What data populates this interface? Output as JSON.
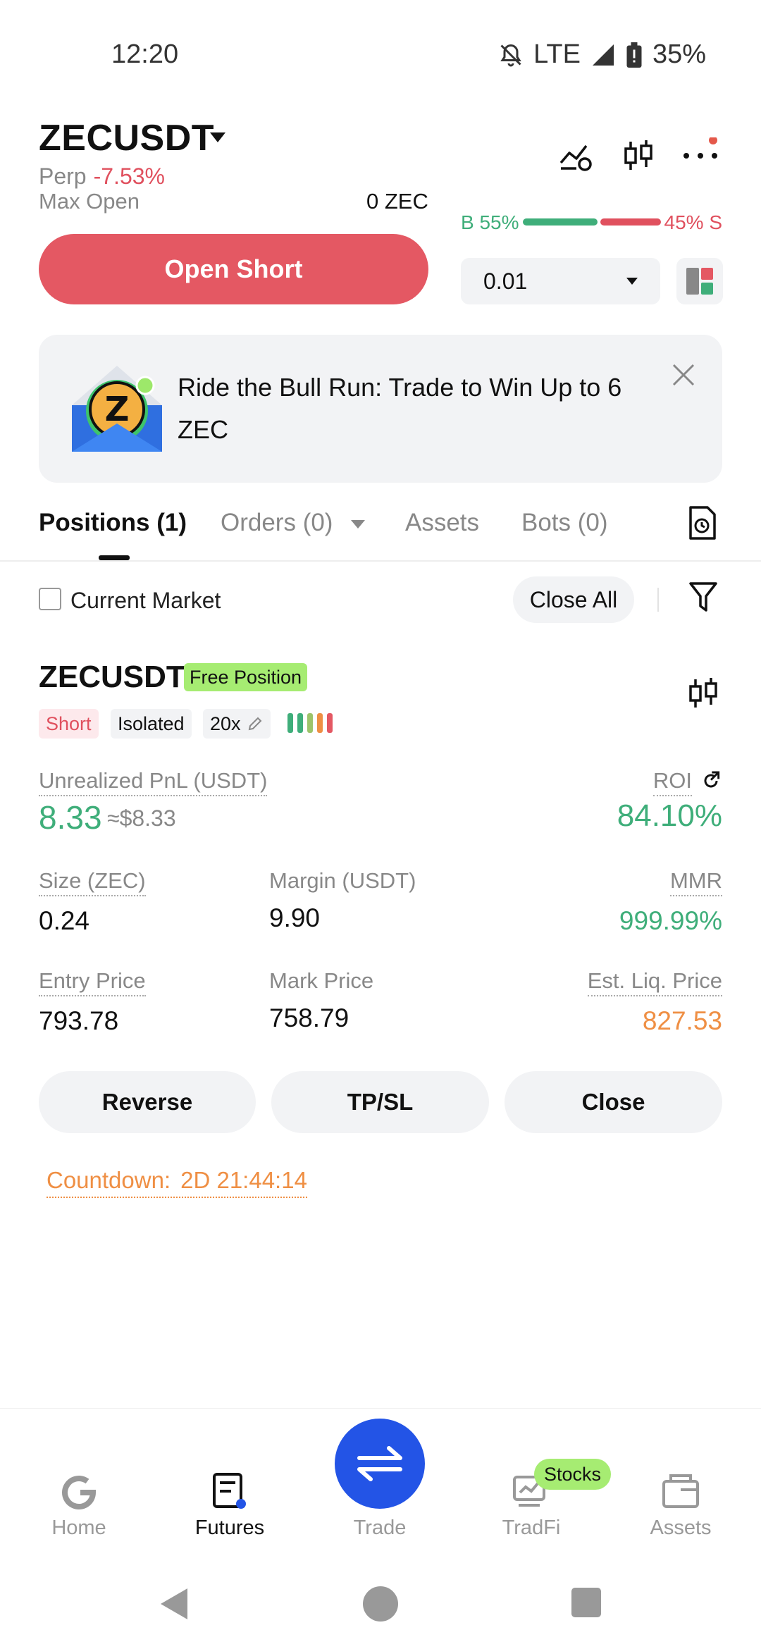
{
  "status_bar": {
    "time": "12:20",
    "network": "LTE",
    "battery": "35%"
  },
  "header": {
    "pair": "ZECUSDT",
    "perp_label": "Perp",
    "change": "-7.53%",
    "max_open_label": "Max Open",
    "max_open_value": "0 ZEC",
    "buy_ratio_label": "B 55%",
    "sell_ratio_label": "45% S",
    "buy_ratio": 0.55,
    "open_short_label": "Open Short",
    "qty_value": "0.01"
  },
  "banner": {
    "text": "Ride the Bull Run: Trade to Win Up to 6 ZEC"
  },
  "tabs": [
    {
      "label": "Positions (1)",
      "active": true
    },
    {
      "label": "Orders (0)",
      "active": false
    },
    {
      "label": "Assets",
      "active": false
    },
    {
      "label": "Bots (0)",
      "active": false
    }
  ],
  "filters": {
    "current_market_label": "Current Market",
    "close_all_label": "Close All"
  },
  "position": {
    "symbol": "ZECUSDT",
    "badge": "Free Position",
    "side": "Short",
    "margin_mode": "Isolated",
    "leverage": "20x",
    "unrealized_pnl_label": "Unrealized PnL (USDT)",
    "unrealized_pnl": "8.33",
    "unrealized_pnl_approx": "≈$8.33",
    "roi_label": "ROI",
    "roi": "84.10%",
    "size_label": "Size (ZEC)",
    "size": "0.24",
    "margin_label": "Margin (USDT)",
    "margin": "9.90",
    "mmr_label": "MMR",
    "mmr": "999.99%",
    "entry_price_label": "Entry Price",
    "entry_price": "793.78",
    "mark_price_label": "Mark Price",
    "mark_price": "758.79",
    "liq_price_label": "Est. Liq. Price",
    "liq_price": "827.53",
    "actions": {
      "reverse": "Reverse",
      "tpsl": "TP/SL",
      "close": "Close"
    },
    "countdown_label": "Countdown:",
    "countdown_value": "2D 21:44:14"
  },
  "bottom_nav": {
    "home": "Home",
    "futures": "Futures",
    "trade": "Trade",
    "tradfi": "TradFi",
    "tradfi_badge": "Stocks",
    "assets": "Assets"
  },
  "colors": {
    "red": "#e45863",
    "green": "#3fae7a",
    "orange": "#ef8f44",
    "blue": "#2354e6",
    "badge_green": "#a6ec72"
  }
}
